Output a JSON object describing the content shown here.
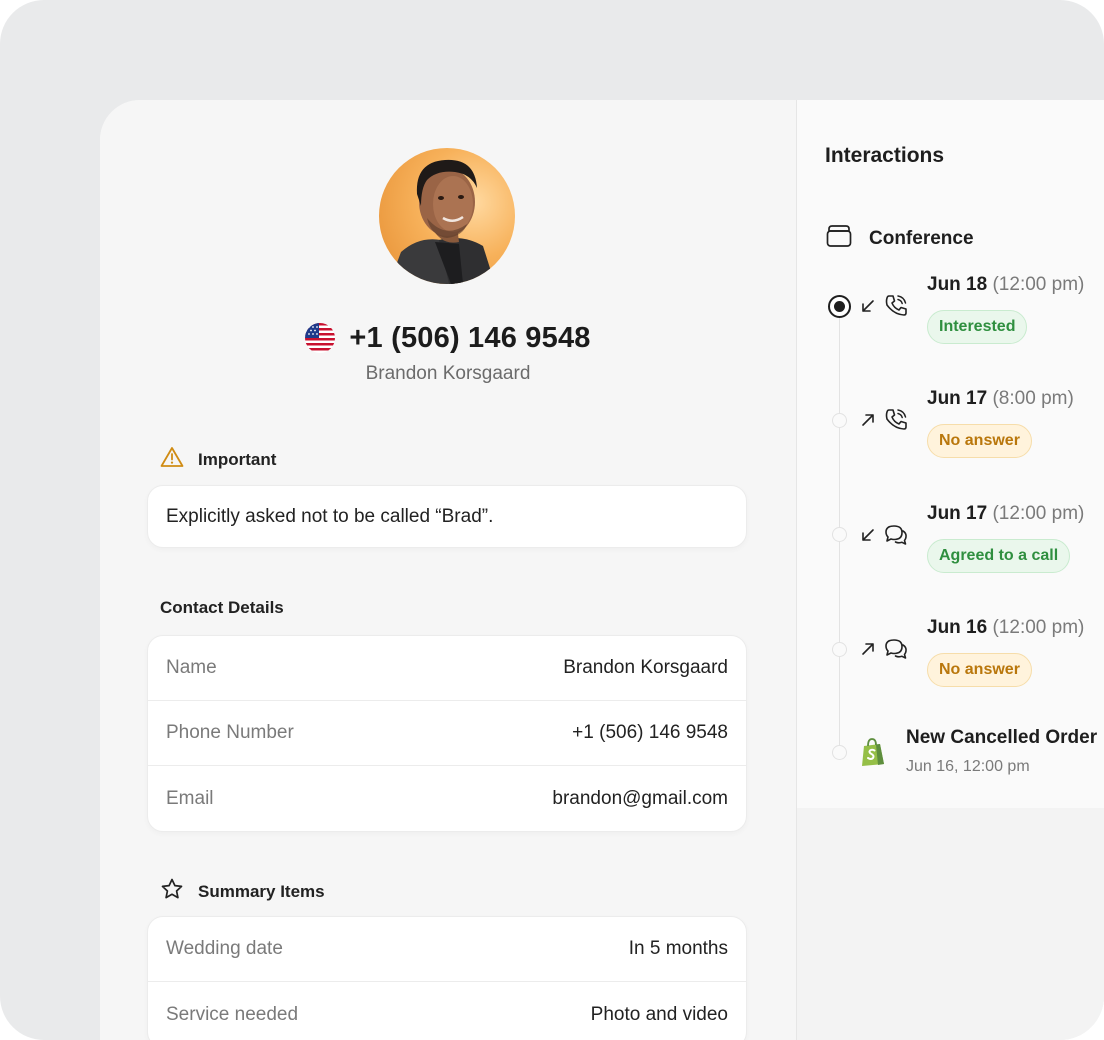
{
  "profile": {
    "phone": "+1 (506) 146 9548",
    "name": "Brandon Korsgaard"
  },
  "important": {
    "heading": "Important",
    "note": "Explicitly asked not to be called “Brad”."
  },
  "contact": {
    "heading": "Contact Details",
    "rows": [
      {
        "label": "Name",
        "value": "Brandon Korsgaard"
      },
      {
        "label": "Phone Number",
        "value": "+1 (506) 146 9548"
      },
      {
        "label": "Email",
        "value": "brandon@gmail.com"
      }
    ]
  },
  "summary": {
    "heading": "Summary Items",
    "rows": [
      {
        "label": "Wedding date",
        "value": "In 5 months"
      },
      {
        "label": "Service needed",
        "value": "Photo and video"
      }
    ]
  },
  "interactions": {
    "title": "Interactions",
    "group": "Conference",
    "entries": [
      {
        "date": "Jun 18",
        "time": "(12:00 pm)",
        "direction": "incoming",
        "channel": "call",
        "status": "Interested",
        "status_color": "#2f8f3f"
      },
      {
        "date": "Jun 17",
        "time": "(8:00 pm)",
        "direction": "outgoing",
        "channel": "call",
        "status": "No answer",
        "status_color": "#b9770c"
      },
      {
        "date": "Jun 17",
        "time": "(12:00 pm)",
        "direction": "incoming",
        "channel": "chat",
        "status": "Agreed to a call",
        "status_color": "#2f8f3f"
      },
      {
        "date": "Jun 16",
        "time": "(12:00 pm)",
        "direction": "outgoing",
        "channel": "chat",
        "status": "No answer",
        "status_color": "#b9770c"
      }
    ],
    "order": {
      "title": "New Cancelled Order",
      "subtitle": "Jun 16, 12:00 pm",
      "icon": "shopify-bag-icon"
    }
  }
}
